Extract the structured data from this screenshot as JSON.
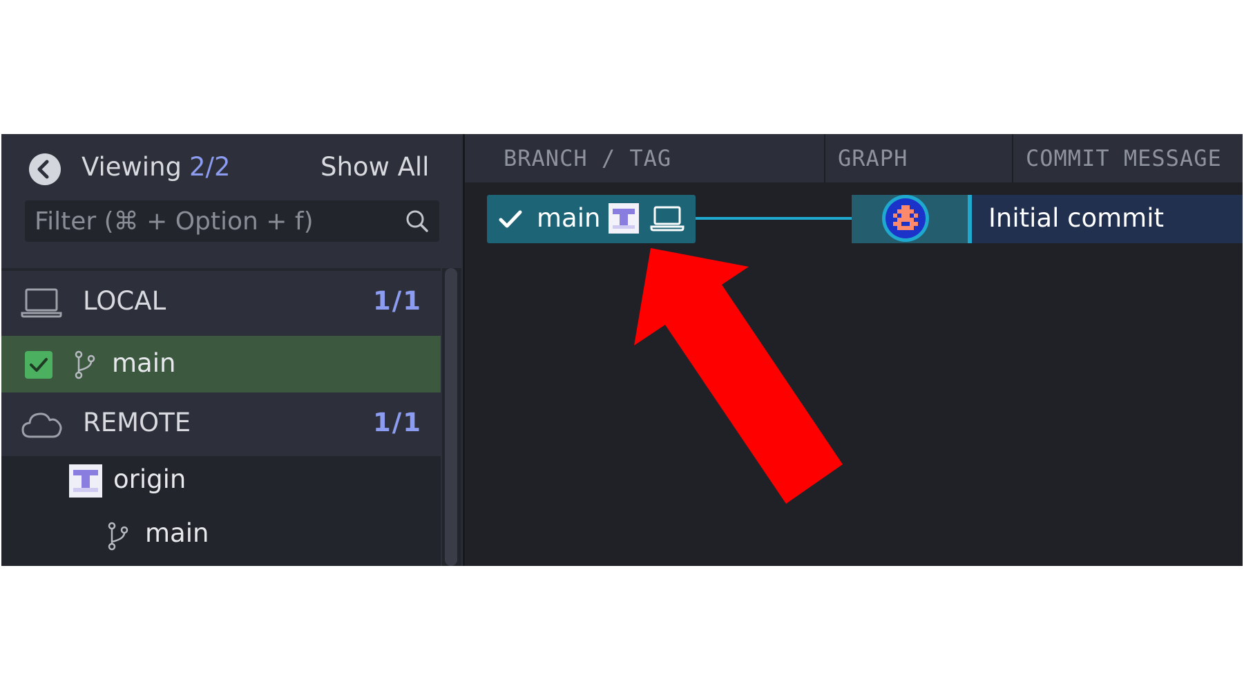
{
  "sidebar": {
    "viewing_label": "Viewing",
    "viewing_count": "2/2",
    "show_all_label": "Show All",
    "filter_placeholder": "Filter (⌘ + Option + f)",
    "sections": {
      "local": {
        "label": "LOCAL",
        "count": "1/1",
        "icon": "laptop-icon"
      },
      "remote": {
        "label": "REMOTE",
        "count": "1/1",
        "icon": "cloud-icon"
      }
    },
    "local_branches": [
      {
        "label": "main",
        "checked": true
      }
    ],
    "remotes": [
      {
        "label": "origin",
        "branches": [
          {
            "label": "main"
          }
        ]
      }
    ]
  },
  "graph": {
    "columns": {
      "branch_tag": "BRANCH / TAG",
      "graph": "GRAPH",
      "commit_message": "COMMIT MESSAGE"
    },
    "rows": [
      {
        "branch": "main",
        "message": "Initial commit",
        "is_checked_out": true
      }
    ]
  },
  "colors": {
    "accent_count": "#8c9cf0",
    "selected_row": "#3c5940",
    "branch_pill": "#1d6477",
    "graph_line": "#1fa9cf",
    "annotation_arrow": "#ff0000"
  }
}
